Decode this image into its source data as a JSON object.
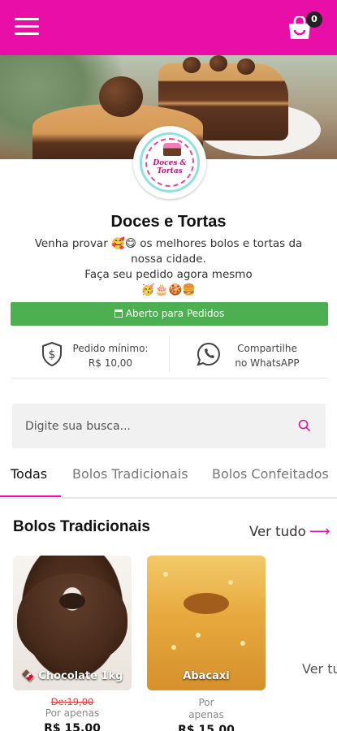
{
  "header": {
    "cart_count": "0",
    "brand_color": "#e90ea7"
  },
  "store": {
    "logo_text_1": "Doces &",
    "logo_text_2": "Tortas",
    "name": "Doces e Tortas",
    "description_line1": "Venha provar 🥰😋 os melhores bolos e tortas da nossa cidade.",
    "description_line2": "Faça seu pedido agora mesmo",
    "description_line3": "🥳🎂🍪🍔",
    "status": "Aberto para Pedidos",
    "status_color": "#4caf50",
    "min_order_label": "Pedido mínimo:",
    "min_order_value": "R$ 10,00",
    "share_label_1": "Compartilhe",
    "share_label_2": "no WhatsAPP"
  },
  "search": {
    "placeholder": "Digite sua busca..."
  },
  "tabs": [
    {
      "label": "Todas",
      "active": true
    },
    {
      "label": "Bolos Tradicionais",
      "active": false
    },
    {
      "label": "Bolos Confeitados",
      "active": false
    }
  ],
  "section": {
    "title": "Bolos Tradicionais",
    "see_all": "Ver tudo",
    "peek": "Ver tu",
    "products": [
      {
        "name": "🍫 Chocolate 1kg",
        "old_price": "De:19,00",
        "sub": "Por apenas",
        "price": "R$ 15,00"
      },
      {
        "name": "Abacaxi",
        "old_price": "",
        "sub1": "Por",
        "sub2": "apenas",
        "price": "R$ 15,00"
      }
    ]
  }
}
